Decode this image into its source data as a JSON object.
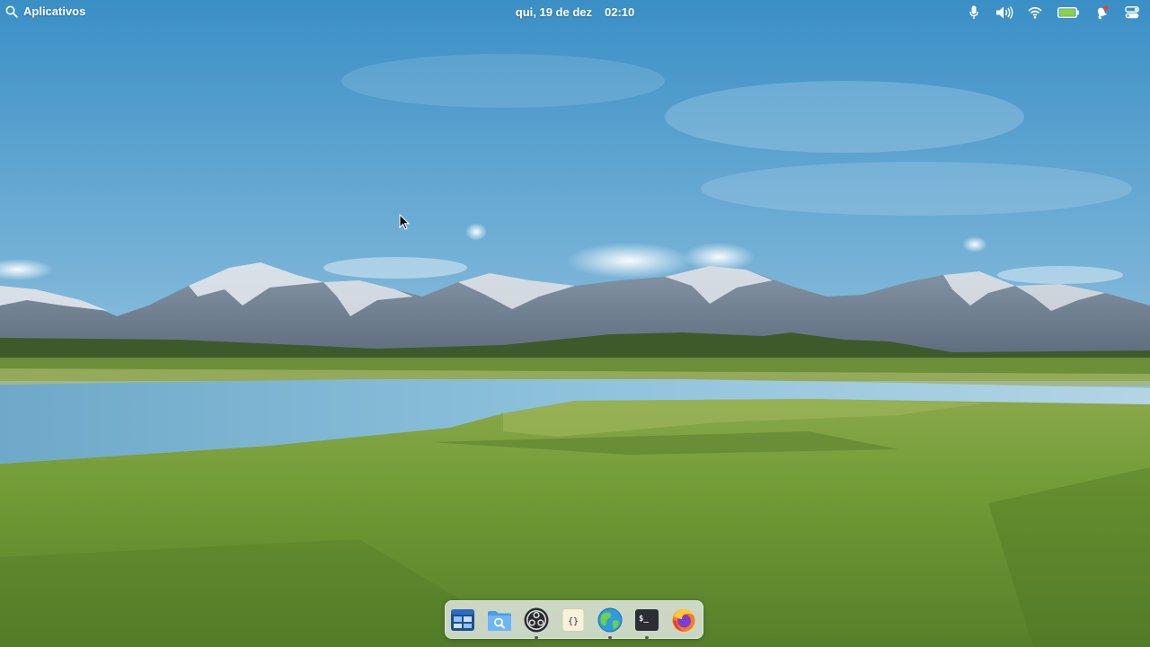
{
  "topbar": {
    "apps_label": "Aplicativos",
    "date": "qui, 19 de dez",
    "time": "02:10",
    "tray_icons": [
      "microphone-icon",
      "volume-icon",
      "wifi-icon",
      "battery-icon",
      "notifications-icon",
      "system-menu-icon"
    ],
    "battery_level": 1.0
  },
  "dock": {
    "apps": [
      {
        "name": "Multitasking View",
        "icon": "multitasking-icon",
        "running": false
      },
      {
        "name": "Files",
        "icon": "files-icon",
        "running": false
      },
      {
        "name": "OBS Studio",
        "icon": "obs-icon",
        "running": true
      },
      {
        "name": "Code",
        "icon": "code-editor-icon",
        "running": false
      },
      {
        "name": "Web Browser",
        "icon": "globe-browser-icon",
        "running": true
      },
      {
        "name": "Terminal",
        "icon": "terminal-icon",
        "running": true
      },
      {
        "name": "Firefox",
        "icon": "firefox-icon",
        "running": false
      }
    ]
  },
  "colors": {
    "sky_top": "#3c92c8",
    "sky_horizon": "#cfe4ee",
    "grass": "#6e9636",
    "water": "#7fb7d4",
    "dock_bg": "#ebeef0"
  }
}
